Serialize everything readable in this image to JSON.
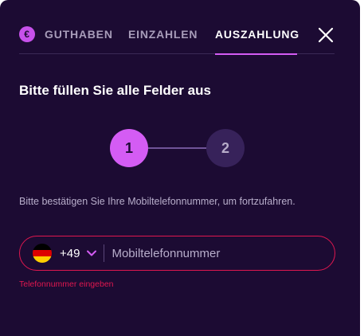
{
  "tabs": [
    {
      "label": "GUTHABEN",
      "icon": "euro-icon",
      "active": false
    },
    {
      "label": "EINZAHLEN",
      "active": false
    },
    {
      "label": "AUSZAHLUNG",
      "active": true
    }
  ],
  "icons": {
    "euro": "€",
    "close": "close-icon",
    "chevron": "chevron-down-icon"
  },
  "heading": "Bitte füllen Sie alle Felder aus",
  "stepper": {
    "steps": [
      "1",
      "2"
    ],
    "current": 1
  },
  "info_text": "Bitte bestätigen Sie Ihre Mobiltelefonnummer, um fortzufahren.",
  "phone": {
    "country_code": "+49",
    "country_flag": "germany-flag-icon",
    "placeholder": "Mobiltelefonnummer",
    "value": ""
  },
  "error_text": "Telefonnummer eingeben",
  "colors": {
    "background": "#1c0b33",
    "accent": "#d45cf4",
    "error": "#e0174f",
    "step_inactive": "#37225a"
  }
}
